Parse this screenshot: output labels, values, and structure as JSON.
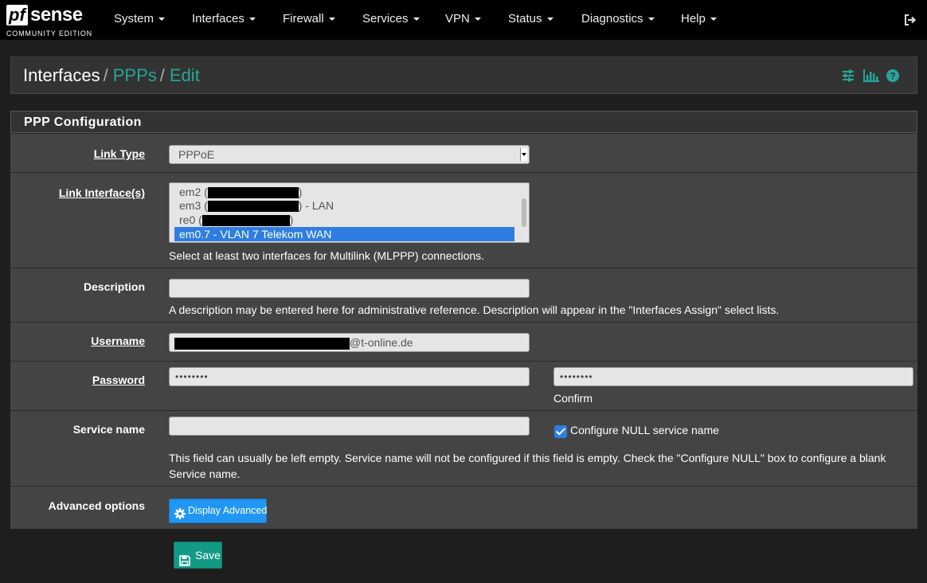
{
  "brand": {
    "logo_pf": "pf",
    "logo_sense": "sense",
    "edition": "COMMUNITY EDITION"
  },
  "nav": {
    "items": [
      "System",
      "Interfaces",
      "Firewall",
      "Services",
      "VPN",
      "Status",
      "Diagnostics",
      "Help"
    ],
    "logout_icon": "sign-out-icon"
  },
  "breadcrumb": {
    "root": "Interfaces",
    "sep": "/",
    "ppps": "PPPs",
    "edit": "Edit"
  },
  "breadcrumb_icons": [
    "sliders-icon",
    "bar-chart-icon",
    "question-circle-icon"
  ],
  "panel": {
    "title": "PPP Configuration"
  },
  "link_type": {
    "label": "Link Type",
    "value": "PPPoE"
  },
  "link_interfaces": {
    "label": "Link Interface(s)",
    "options": [
      {
        "prefix": "em2 (",
        "suffix": ")"
      },
      {
        "prefix": "em3 (",
        "suffix": ") - LAN"
      },
      {
        "prefix": "re0 (",
        "suffix": ")"
      },
      {
        "prefix": "em0.7 - VLAN 7 Telekom WAN",
        "suffix": ""
      }
    ],
    "help": "Select at least two interfaces for Multilink (MLPPP) connections."
  },
  "description": {
    "label": "Description",
    "value": "",
    "help": "A description may be entered here for administrative reference. Description will appear in the \"Interfaces Assign\" select lists."
  },
  "username": {
    "label": "Username",
    "value_suffix": "@t-online.de"
  },
  "password": {
    "label": "Password",
    "value": "••••••••",
    "confirm_value": "••••••••",
    "confirm_label": "Confirm"
  },
  "service_name": {
    "label": "Service name",
    "value": "",
    "null_label": "Configure NULL service name",
    "null_checked": true,
    "help": "This field can usually be left empty. Service name will not be configured if this field is empty. Check the \"Configure NULL\" box to configure a blank Service name."
  },
  "advanced": {
    "label": "Advanced options",
    "button": "Display Advanced"
  },
  "save": {
    "label": "Save"
  },
  "colors": {
    "accent": "#26a69a",
    "primary": "#2196f3",
    "success": "#139a85",
    "navbar": "#000000",
    "panel": "#444444"
  }
}
